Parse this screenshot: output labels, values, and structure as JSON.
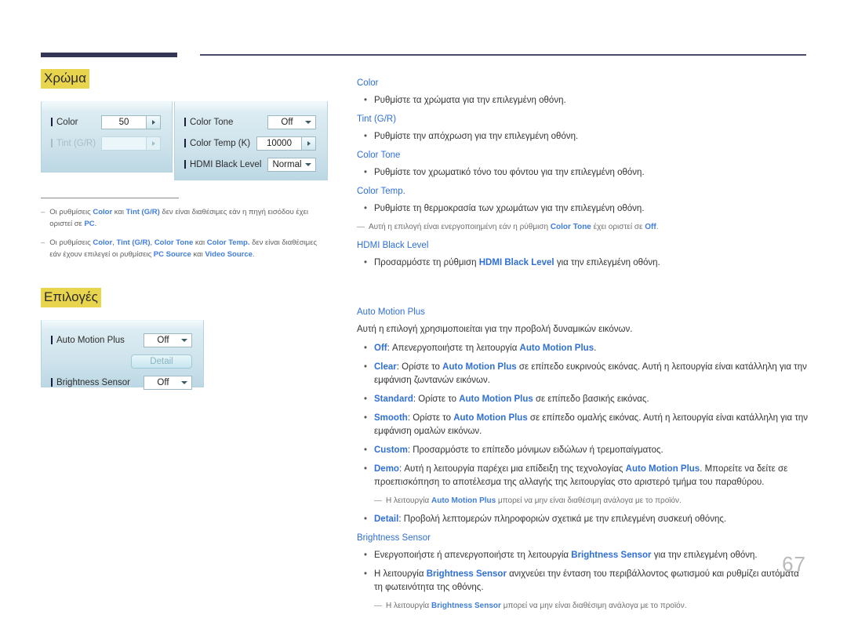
{
  "page": {
    "number": "67"
  },
  "left": {
    "section1": {
      "heading": "Χρώμα",
      "panel_left": {
        "rows": [
          {
            "label": "Color",
            "value": "50",
            "control": "spinner",
            "disabled": false
          },
          {
            "label": "Tint (G/R)",
            "value": "",
            "control": "spinner",
            "disabled": true
          }
        ]
      },
      "panel_right": {
        "rows": [
          {
            "label": "Color Tone",
            "value": "Off",
            "control": "dropdown",
            "disabled": false
          },
          {
            "label": "Color Temp (K)",
            "value": "10000",
            "control": "spinner",
            "disabled": false
          },
          {
            "label": "HDMI Black Level",
            "value": "Normal",
            "control": "dropdown",
            "disabled": false
          }
        ]
      },
      "notes": [
        {
          "dash": "–",
          "parts": [
            {
              "t": "Οι ρυθμίσεις ",
              "kw": false
            },
            {
              "t": "Color",
              "kw": true
            },
            {
              "t": " και ",
              "kw": false
            },
            {
              "t": "Tint (G/R)",
              "kw": true
            },
            {
              "t": " δεν είναι διαθέσιμες εάν η πηγή εισόδου έχει οριστεί σε ",
              "kw": false
            },
            {
              "t": "PC",
              "kw": true
            },
            {
              "t": ".",
              "kw": false
            }
          ]
        },
        {
          "dash": "–",
          "parts": [
            {
              "t": "Οι ρυθμίσεις ",
              "kw": false
            },
            {
              "t": "Color",
              "kw": true
            },
            {
              "t": ", ",
              "kw": false
            },
            {
              "t": "Tint (G/R)",
              "kw": true
            },
            {
              "t": ", ",
              "kw": false
            },
            {
              "t": "Color Tone",
              "kw": true
            },
            {
              "t": " και ",
              "kw": false
            },
            {
              "t": "Color Temp.",
              "kw": true
            },
            {
              "t": " δεν είναι διαθέσιμες εάν έχουν επιλεγεί οι ρυθμίσεις ",
              "kw": false
            },
            {
              "t": "PC Source",
              "kw": true
            },
            {
              "t": " και ",
              "kw": false
            },
            {
              "t": "Video Source",
              "kw": true
            },
            {
              "t": ".",
              "kw": false
            }
          ]
        }
      ]
    },
    "section2": {
      "heading": "Επιλογές",
      "panel": {
        "rows": [
          {
            "label": "Auto Motion Plus",
            "value": "Off",
            "control": "dropdown",
            "disabled": false
          },
          {
            "label": "",
            "value": "Detail",
            "control": "button",
            "disabled": true
          },
          {
            "label": "Brightness Sensor",
            "value": "Off",
            "control": "dropdown",
            "disabled": false
          }
        ]
      }
    }
  },
  "right": {
    "blocks": [
      {
        "type": "head",
        "text": "Color"
      },
      {
        "type": "bullet",
        "parts": [
          {
            "t": "Ρυθμίστε τα χρώματα για την επιλεγμένη οθόνη.",
            "kw": false
          }
        ]
      },
      {
        "type": "head",
        "text": "Tint (G/R)"
      },
      {
        "type": "bullet",
        "parts": [
          {
            "t": "Ρυθμίστε την απόχρωση για την επιλεγμένη οθόνη.",
            "kw": false
          }
        ]
      },
      {
        "type": "head",
        "text": "Color Tone"
      },
      {
        "type": "bullet",
        "parts": [
          {
            "t": "Ρυθμίστε τον χρωματικό τόνο του φόντου για την επιλεγμένη οθόνη.",
            "kw": false
          }
        ]
      },
      {
        "type": "head",
        "text": "Color Temp."
      },
      {
        "type": "bullet",
        "parts": [
          {
            "t": "Ρυθμίστε τη θερμοκρασία των χρωμάτων για την επιλεγμένη οθόνη.",
            "kw": false
          }
        ]
      },
      {
        "type": "subnote-flush",
        "dash": "―",
        "parts": [
          {
            "t": "Αυτή η επιλογή είναι ενεργοποιημένη εάν η ρύθμιση ",
            "kw": false
          },
          {
            "t": "Color Tone",
            "kw": true
          },
          {
            "t": " έχει οριστεί σε ",
            "kw": false
          },
          {
            "t": "Off",
            "kw": true
          },
          {
            "t": ".",
            "kw": false
          }
        ]
      },
      {
        "type": "head",
        "text": "HDMI Black Level"
      },
      {
        "type": "bullet",
        "parts": [
          {
            "t": "Προσαρμόστε τη ρύθμιση ",
            "kw": false
          },
          {
            "t": "HDMI Black Level",
            "kw": true
          },
          {
            "t": " για την επιλεγμένη οθόνη.",
            "kw": false
          }
        ]
      },
      {
        "type": "head-biggap",
        "text": "Auto Motion Plus"
      },
      {
        "type": "para",
        "parts": [
          {
            "t": "Αυτή η επιλογή χρησιμοποιείται για την προβολή δυναμικών εικόνων.",
            "kw": false
          }
        ]
      },
      {
        "type": "bullet",
        "parts": [
          {
            "t": "Off",
            "kw": true
          },
          {
            "t": ": Απενεργοποιήστε τη λειτουργία ",
            "kw": false
          },
          {
            "t": "Auto Motion Plus",
            "kw": true
          },
          {
            "t": ".",
            "kw": false
          }
        ]
      },
      {
        "type": "bullet",
        "parts": [
          {
            "t": "Clear",
            "kw": true
          },
          {
            "t": ": Ορίστε το ",
            "kw": false
          },
          {
            "t": "Auto Motion Plus",
            "kw": true
          },
          {
            "t": " σε επίπεδο ευκρινούς εικόνας. Αυτή η λειτουργία είναι κατάλληλη για την εμφάνιση ζωντανών εικόνων.",
            "kw": false
          }
        ]
      },
      {
        "type": "bullet",
        "parts": [
          {
            "t": "Standard",
            "kw": true
          },
          {
            "t": ": Ορίστε το ",
            "kw": false
          },
          {
            "t": "Auto Motion Plus",
            "kw": true
          },
          {
            "t": " σε επίπεδο βασικής εικόνας.",
            "kw": false
          }
        ]
      },
      {
        "type": "bullet",
        "parts": [
          {
            "t": "Smooth",
            "kw": true
          },
          {
            "t": ": Ορίστε το ",
            "kw": false
          },
          {
            "t": "Auto Motion Plus",
            "kw": true
          },
          {
            "t": " σε επίπεδο ομαλής εικόνας. Αυτή η λειτουργία είναι κατάλληλη για την εμφάνιση ομαλών εικόνων.",
            "kw": false
          }
        ]
      },
      {
        "type": "bullet",
        "parts": [
          {
            "t": "Custom",
            "kw": true
          },
          {
            "t": ": Προσαρμόστε το επίπεδο μόνιμων ειδώλων ή τρεμοπαίγματος.",
            "kw": false
          }
        ]
      },
      {
        "type": "bullet",
        "parts": [
          {
            "t": "Demo",
            "kw": true
          },
          {
            "t": ": Αυτή η λειτουργία παρέχει μια επίδειξη της τεχνολογίας ",
            "kw": false
          },
          {
            "t": "Auto Motion Plus",
            "kw": true
          },
          {
            "t": ". Μπορείτε να δείτε σε προεπισκόπηση το αποτέλεσμα της αλλαγής της λειτουργίας στο αριστερό τμήμα του παραθύρου.",
            "kw": false
          }
        ]
      },
      {
        "type": "subnote",
        "dash": "―",
        "parts": [
          {
            "t": "Η λειτουργία ",
            "kw": false
          },
          {
            "t": "Auto Motion Plus",
            "kw": true
          },
          {
            "t": " μπορεί να μην είναι διαθέσιμη ανάλογα με το προϊόν.",
            "kw": false
          }
        ]
      },
      {
        "type": "bullet",
        "parts": [
          {
            "t": "Detail",
            "kw": true
          },
          {
            "t": ": Προβολή λεπτομερών πληροφοριών σχετικά με την επιλεγμένη συσκευή οθόνης.",
            "kw": false
          }
        ]
      },
      {
        "type": "head",
        "text": "Brightness Sensor"
      },
      {
        "type": "bullet",
        "parts": [
          {
            "t": "Ενεργοποιήστε ή απενεργοποιήστε τη λειτουργία ",
            "kw": false
          },
          {
            "t": "Brightness Sensor",
            "kw": true
          },
          {
            "t": " για την επιλεγμένη οθόνη.",
            "kw": false
          }
        ]
      },
      {
        "type": "bullet",
        "parts": [
          {
            "t": "Η λειτουργία ",
            "kw": false
          },
          {
            "t": "Brightness Sensor",
            "kw": true
          },
          {
            "t": " ανιχνεύει την ένταση του περιβάλλοντος φωτισμού και ρυθμίζει αυτόματα τη φωτεινότητα της οθόνης.",
            "kw": false
          }
        ]
      },
      {
        "type": "subnote",
        "dash": "―",
        "parts": [
          {
            "t": "Η λειτουργία ",
            "kw": false
          },
          {
            "t": "Brightness Sensor",
            "kw": true
          },
          {
            "t": " μπορεί να μην είναι διαθέσιμη ανάλογα με το προϊόν.",
            "kw": false
          }
        ]
      }
    ]
  },
  "colors": {
    "accent_blue": "#2f6fd6",
    "highlight_yellow": "#e8d44d",
    "header_navy": "#343655",
    "page_num_gray": "#b9b9b9"
  }
}
